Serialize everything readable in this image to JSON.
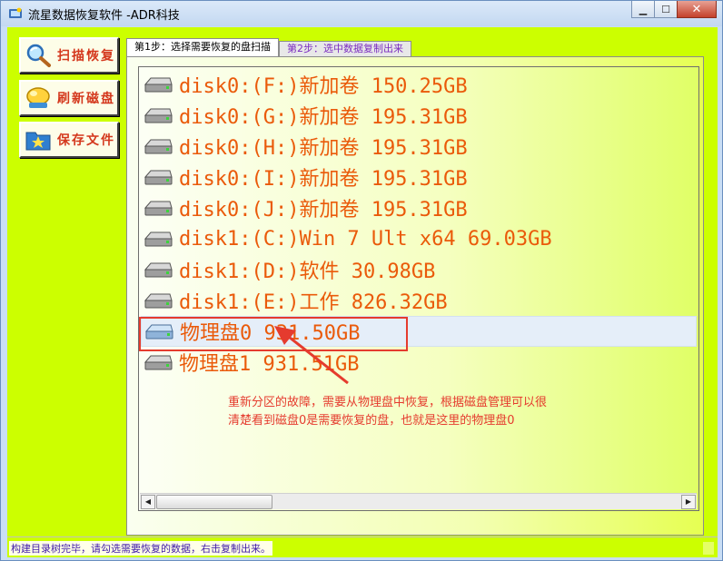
{
  "window": {
    "title": "流星数据恢复软件  -ADR科技",
    "controls": {
      "minimize": "▁",
      "maximize": "☐",
      "close": "✕"
    }
  },
  "sidebar": {
    "buttons": [
      {
        "label": "扫描恢复",
        "icon": "magnifier-icon"
      },
      {
        "label": "刷新磁盘",
        "icon": "refresh-disk-icon"
      },
      {
        "label": "保存文件",
        "icon": "save-file-icon"
      }
    ]
  },
  "tabs": [
    {
      "label": "第1步：选择需要恢复的盘扫描",
      "active": true
    },
    {
      "label": "第2步：选中数据复制出来",
      "active": false
    }
  ],
  "disk_list": {
    "items": [
      {
        "label": "disk0:(F:)新加卷 150.25GB",
        "selected": false
      },
      {
        "label": "disk0:(G:)新加卷 195.31GB",
        "selected": false
      },
      {
        "label": "disk0:(H:)新加卷 195.31GB",
        "selected": false
      },
      {
        "label": "disk0:(I:)新加卷 195.31GB",
        "selected": false
      },
      {
        "label": "disk0:(J:)新加卷 195.31GB",
        "selected": false
      },
      {
        "label": "disk1:(C:)Win 7 Ult x64 69.03GB",
        "selected": false
      },
      {
        "label": "disk1:(D:)软件 30.98GB",
        "selected": false
      },
      {
        "label": "disk1:(E:)工作 826.32GB",
        "selected": false
      },
      {
        "label": "物理盘0 931.50GB",
        "selected": true
      },
      {
        "label": "物理盘1 931.51GB",
        "selected": false
      }
    ]
  },
  "annotation": {
    "line1": "重新分区的故障，需要从物理盘中恢复，根据磁盘管理可以很",
    "line2": "清楚看到磁盘0是需要恢复的盘，也就是这里的物理盘0",
    "color": "#e53b2e"
  },
  "scrollbar": {
    "left_arrow": "◀",
    "right_arrow": "▶"
  },
  "status": {
    "text": "构建目录树完毕，请勾选需要恢复的数据，右击复制出来。"
  },
  "colors": {
    "client_bg": "#ccff00",
    "item_text": "#ea5a0a",
    "button_label": "#d4371c",
    "status_text": "#3f1aa9"
  }
}
